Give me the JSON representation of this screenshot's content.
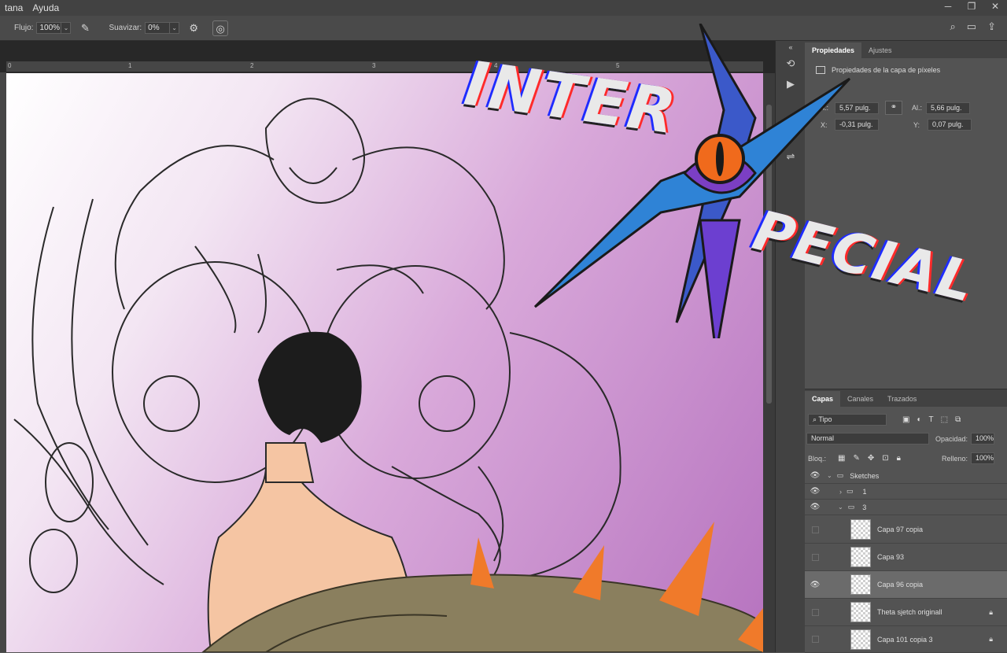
{
  "menubar": {
    "items": [
      "tana",
      "Ayuda"
    ]
  },
  "options": {
    "flow_label": "Flujo:",
    "flow_value": "100%",
    "smooth_label": "Suavizar:",
    "smooth_value": "0%"
  },
  "ruler": {
    "ticks": [
      "0",
      "1",
      "2",
      "3",
      "4",
      "5"
    ]
  },
  "artwork": {
    "logo_word_1": "INTER",
    "logo_word_2": "PECIAL"
  },
  "properties_panel": {
    "tabs": [
      "Propiedades",
      "Ajustes"
    ],
    "title": "Propiedades de la capa de píxeles",
    "width_label": "An.:",
    "width_value": "5,57 pulg.",
    "height_label": "Al.:",
    "height_value": "5,66 pulg.",
    "x_label": "X:",
    "x_value": "-0,31 pulg.",
    "y_label": "Y:",
    "y_value": "0,07 pulg."
  },
  "layers_panel": {
    "tabs": [
      "Capas",
      "Canales",
      "Trazados"
    ],
    "filter_value": "Tipo",
    "blend_mode": "Normal",
    "opacity_label": "Opacidad:",
    "opacity_value": "100%",
    "lock_label": "Bloq.:",
    "fill_label": "Relleno:",
    "fill_value": "100%",
    "layers": [
      {
        "name": "Sketches",
        "type": "group",
        "visible": true,
        "expanded": true
      },
      {
        "name": "1",
        "type": "group",
        "visible": true,
        "expanded": false
      },
      {
        "name": "3",
        "type": "group",
        "visible": true,
        "expanded": true
      },
      {
        "name": "Capa 97 copia",
        "type": "layer",
        "visible": false,
        "locked": false
      },
      {
        "name": "Capa 93",
        "type": "layer",
        "visible": false,
        "locked": false
      },
      {
        "name": "Capa 96 copia",
        "type": "layer",
        "visible": true,
        "locked": false,
        "selected": true
      },
      {
        "name": "Theta sjetch originall",
        "type": "layer",
        "visible": false,
        "locked": true
      },
      {
        "name": "Capa 101 copia 3",
        "type": "layer",
        "visible": false,
        "locked": true
      }
    ]
  }
}
